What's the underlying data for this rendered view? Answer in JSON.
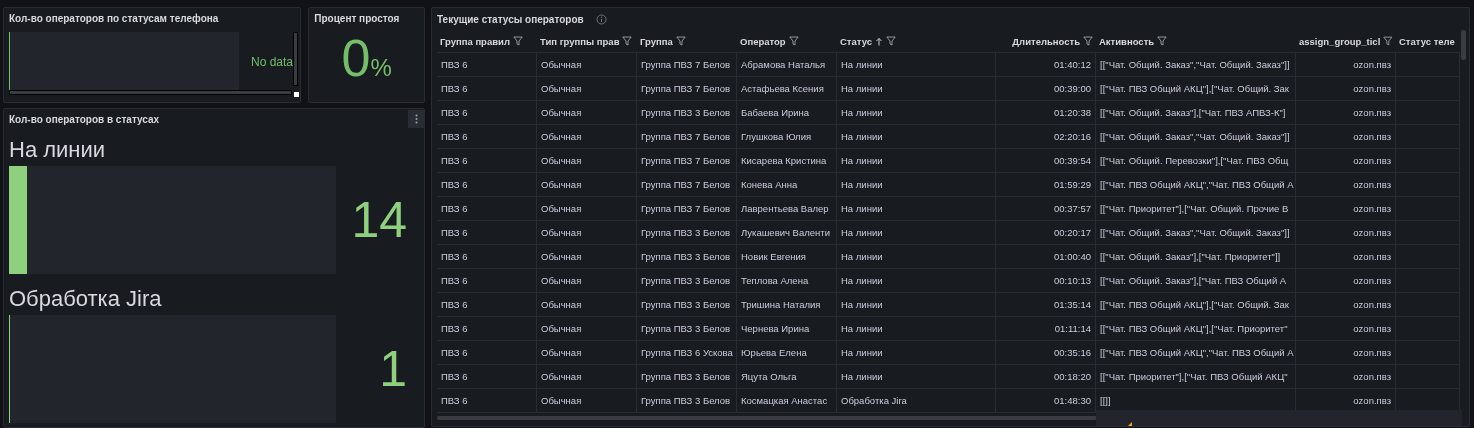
{
  "phone_panel": {
    "title": "Кол-во операторов по статусам телефона",
    "no_data": "No data"
  },
  "idle_panel": {
    "title": "Процент простоя",
    "value": "0",
    "unit": "%"
  },
  "status_panel": {
    "title": "Кол-во операторов в статусах",
    "gauges": [
      {
        "label": "На линии",
        "value": "14",
        "level": 0.055
      },
      {
        "label": "Обработка Jira",
        "value": "1",
        "level": 0.004
      }
    ]
  },
  "table": {
    "title": "Текущие статусы операторов",
    "columns": [
      {
        "label": "Группа правил",
        "filterable": true,
        "sorted": false
      },
      {
        "label": "Тип группы прав",
        "filterable": true,
        "sorted": false
      },
      {
        "label": "Группа",
        "filterable": true,
        "sorted": false
      },
      {
        "label": "Оператор",
        "filterable": true,
        "sorted": false
      },
      {
        "label": "Статус",
        "filterable": true,
        "sorted": true
      },
      {
        "label": "Длительность",
        "filterable": true,
        "sorted": false
      },
      {
        "label": "Активность",
        "filterable": true,
        "sorted": false
      },
      {
        "label": "assign_group_ticl",
        "filterable": true,
        "sorted": false
      },
      {
        "label": "Статус теле"
      }
    ],
    "rows": [
      [
        "ПВЗ 6",
        "Обычная",
        "Группа ПВЗ 7 Белов",
        "Абрамова Наталья",
        "На линии",
        "01:40:12",
        "[[\"Чат. Общий. Заказ\",\"Чат. Общий. Заказ\"]]",
        "ozon.пвз"
      ],
      [
        "ПВЗ 6",
        "Обычная",
        "Группа ПВЗ 7 Белов",
        "Астафьева Ксения",
        "На линии",
        "00:39:00",
        "[[\"Чат. ПВЗ Общий АКЦ\"],[\"Чат. Общий. Зак",
        "ozon.пвз"
      ],
      [
        "ПВЗ 6",
        "Обычная",
        "Группа ПВЗ 3 Белов",
        "Бабаева Ирина",
        "На линии",
        "01:20:38",
        "[[\"Чат. Общий. Заказ\"],[\"Чат. ПВЗ АПВЗ-К\"]",
        "ozon.пвз"
      ],
      [
        "ПВЗ 6",
        "Обычная",
        "Группа ПВЗ 7 Белов",
        "Глушкова Юлия",
        "На линии",
        "02:20:16",
        "[[\"Чат. Общий. Заказ\",\"Чат. Общий. Заказ\"]]",
        "ozon.пвз"
      ],
      [
        "ПВЗ 6",
        "Обычная",
        "Группа ПВЗ 7 Белов",
        "Кисарева Кристина",
        "На линии",
        "00:39:54",
        "[[\"Чат. Общий. Перевозки\"],[\"Чат. ПВЗ Общ",
        "ozon.пвз"
      ],
      [
        "ПВЗ 6",
        "Обычная",
        "Группа ПВЗ 7 Белов",
        "Конева Анна",
        "На линии",
        "01:59:29",
        "[[\"Чат. ПВЗ Общий АКЦ\",\"Чат. ПВЗ Общий А",
        "ozon.пвз"
      ],
      [
        "ПВЗ 6",
        "Обычная",
        "Группа ПВЗ 7 Белов",
        "Лаврентьева Валер",
        "На линии",
        "00:37:57",
        "[[\"Чат. Приоритет\"],[\"Чат. Общий. Прочие В",
        "ozon.пвз"
      ],
      [
        "ПВЗ 6",
        "Обычная",
        "Группа ПВЗ 3 Белов",
        "Лукашевич Валенти",
        "На линии",
        "00:20:17",
        "[[\"Чат. Общий. Заказ\",\"Чат. Общий. Заказ\"]]",
        "ozon.пвз"
      ],
      [
        "ПВЗ 6",
        "Обычная",
        "Группа ПВЗ 3 Белов",
        "Новик Евгения",
        "На линии",
        "01:00:40",
        "[[\"Чат. Общий. Заказ\"],[\"Чат. Приоритет\"]]",
        "ozon.пвз"
      ],
      [
        "ПВЗ 6",
        "Обычная",
        "Группа ПВЗ 3 Белов",
        "Теплова Алена",
        "На линии",
        "00:10:13",
        "[[\"Чат. Общий. Заказ\"],[\"Чат. ПВЗ Общий А",
        "ozon.пвз"
      ],
      [
        "ПВЗ 6",
        "Обычная",
        "Группа ПВЗ 3 Белов",
        "Тришина Наталия",
        "На линии",
        "01:35:14",
        "[[\"Чат. ПВЗ Общий АКЦ\"],[\"Чат. Общий. Зак",
        "ozon.пвз"
      ],
      [
        "ПВЗ 6",
        "Обычная",
        "Группа ПВЗ 3 Белов",
        "Чернева Ирина",
        "На линии",
        "01:11:14",
        "[[\"Чат. ПВЗ Общий АКЦ\"],[\"Чат. Приоритет\"",
        "ozon.пвз"
      ],
      [
        "ПВЗ 6",
        "Обычная",
        "Группа ПВЗ 6 Ускова",
        "Юрьева Елена",
        "На линии",
        "00:35:16",
        "[[\"Чат. ПВЗ Общий АКЦ\",\"Чат. ПВЗ Общий А",
        "ozon.пвз"
      ],
      [
        "ПВЗ 6",
        "Обычная",
        "Группа ПВЗ 3 Белов",
        "Яцута Ольга",
        "На линии",
        "00:18:20",
        "[[\"Чат. Приоритет\"],[\"Чат. ПВЗ Общий АКЦ\"",
        "ozon.пвз"
      ],
      [
        "ПВЗ 6",
        "Обычная",
        "Группа ПВЗ 3 Белов",
        "Космацкая Анастас",
        "Обработка Jira",
        "01:48:30",
        "[[]]",
        "ozon.пвз"
      ]
    ]
  }
}
